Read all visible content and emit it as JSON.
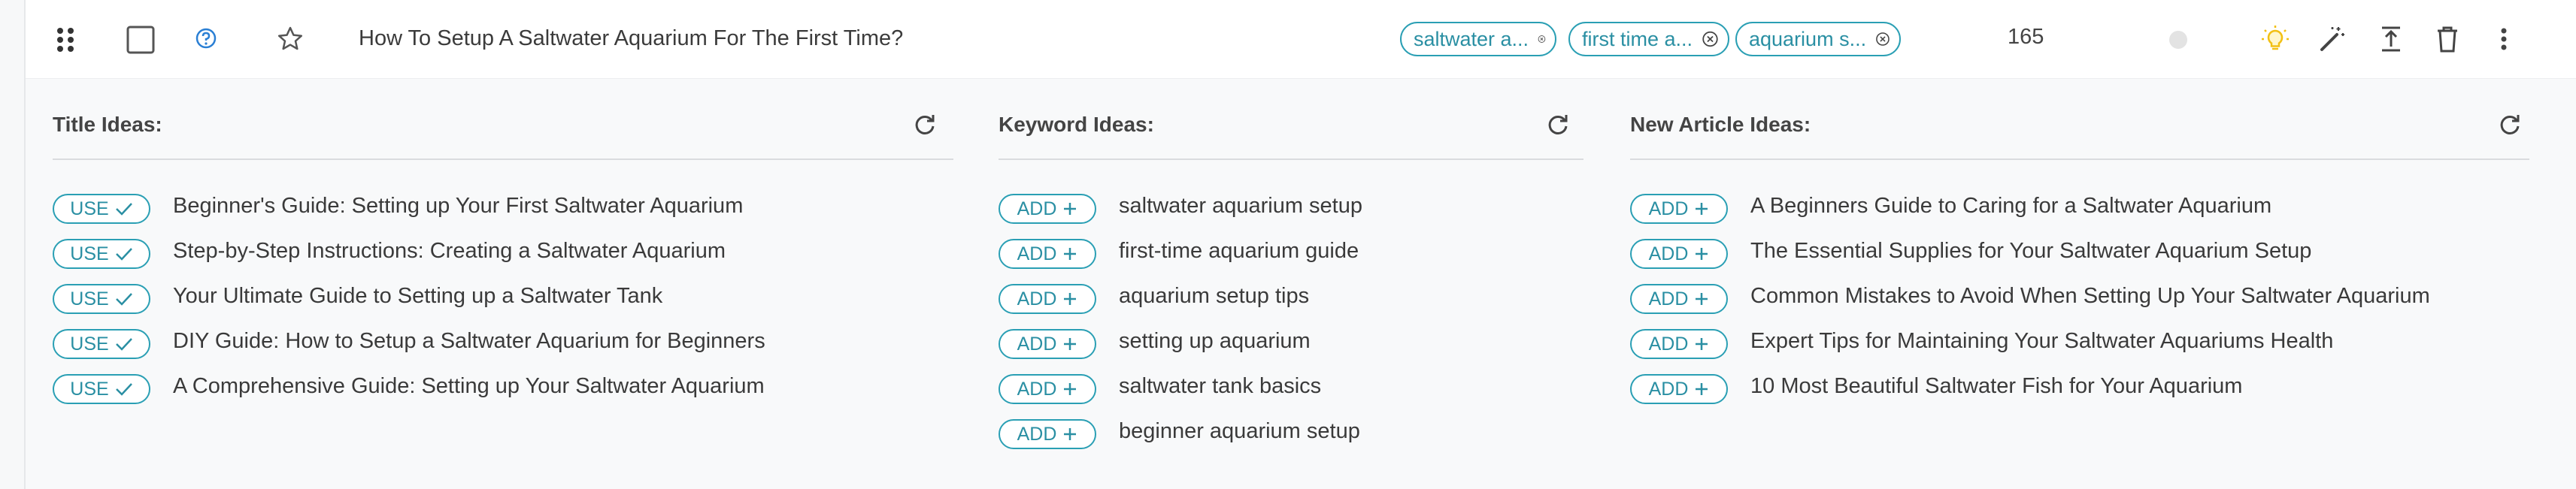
{
  "row": {
    "title": "How To Setup A Saltwater Aquarium For The First Time?",
    "tags": [
      "saltwater a...",
      "first time a...",
      "aquarium s..."
    ],
    "count": "165"
  },
  "panels": {
    "title_ideas": {
      "heading": "Title Ideas:",
      "button_label": "USE",
      "items": [
        "Beginner's Guide: Setting up Your First Saltwater Aquarium",
        "Step-by-Step Instructions: Creating a Saltwater Aquarium",
        "Your Ultimate Guide to Setting up a Saltwater Tank",
        "DIY Guide: How to Setup a Saltwater Aquarium for Beginners",
        "A Comprehensive Guide: Setting up Your Saltwater Aquarium"
      ]
    },
    "keyword_ideas": {
      "heading": "Keyword Ideas:",
      "button_label": "ADD",
      "items": [
        "saltwater aquarium setup",
        "first-time aquarium guide",
        "aquarium setup tips",
        "setting up aquarium",
        "saltwater tank basics",
        "beginner aquarium setup"
      ]
    },
    "article_ideas": {
      "heading": "New Article Ideas:",
      "button_label": "ADD",
      "items": [
        "A Beginners Guide to Caring for a Saltwater Aquarium",
        "The Essential Supplies for Your Saltwater Aquarium Setup",
        "Common Mistakes to Avoid When Setting Up Your Saltwater Aquarium",
        "Expert Tips for Maintaining Your Saltwater Aquariums Health",
        "10 Most Beautiful Saltwater Fish for Your Aquarium"
      ]
    }
  },
  "icons": {
    "drag": "drag-handle-icon",
    "checkbox": "checkbox-icon",
    "help": "help-circle-icon",
    "star": "star-icon",
    "status": "status-dot-icon",
    "idea": "lightbulb-icon",
    "wand": "magic-wand-icon",
    "export": "export-icon",
    "delete": "trash-icon",
    "more": "more-vertical-icon",
    "refresh": "refresh-icon",
    "tag_close": "close-circle-icon"
  },
  "colors": {
    "accent": "#2a9fb4",
    "bulb": "#f2c014",
    "status_dot": "#e3e3e3"
  }
}
